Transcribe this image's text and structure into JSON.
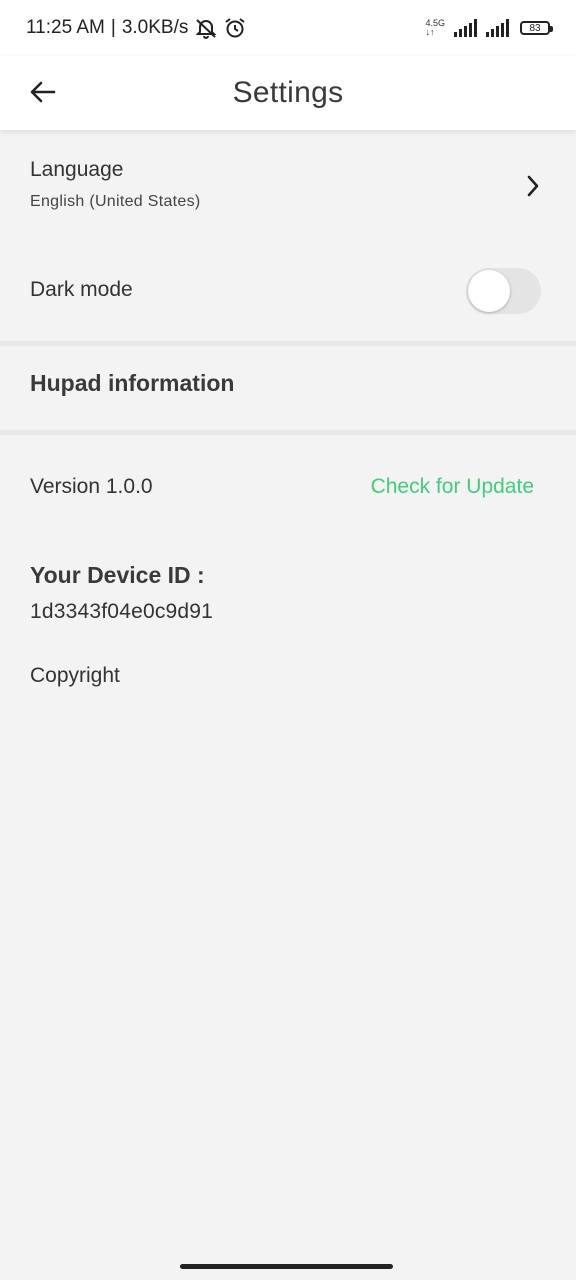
{
  "status_bar": {
    "time": "11:25 AM",
    "separator": "|",
    "speed": "3.0KB/s",
    "network_type": "4.5G",
    "network_sub": "↓↑",
    "battery": "83",
    "icons": [
      "mute-bell-icon",
      "alarm-icon",
      "signal-icon",
      "signal-icon",
      "battery-icon"
    ]
  },
  "app_bar": {
    "title": "Settings",
    "back_icon": "arrow-left-icon"
  },
  "language": {
    "title": "Language",
    "value": "English (United States)",
    "icon": "chevron-right-icon"
  },
  "dark_mode": {
    "label": "Dark mode",
    "enabled": false
  },
  "info": {
    "title": "Hupad information",
    "version": "Version 1.0.0",
    "update_link": "Check for Update",
    "device_label": "Your Device ID :",
    "device_id": "1d3343f04e0c9d91",
    "copyright": "Copyright"
  },
  "colors": {
    "accent": "#3ecf7a",
    "background": "#f3f3f3",
    "toolbar": "#ffffff"
  }
}
